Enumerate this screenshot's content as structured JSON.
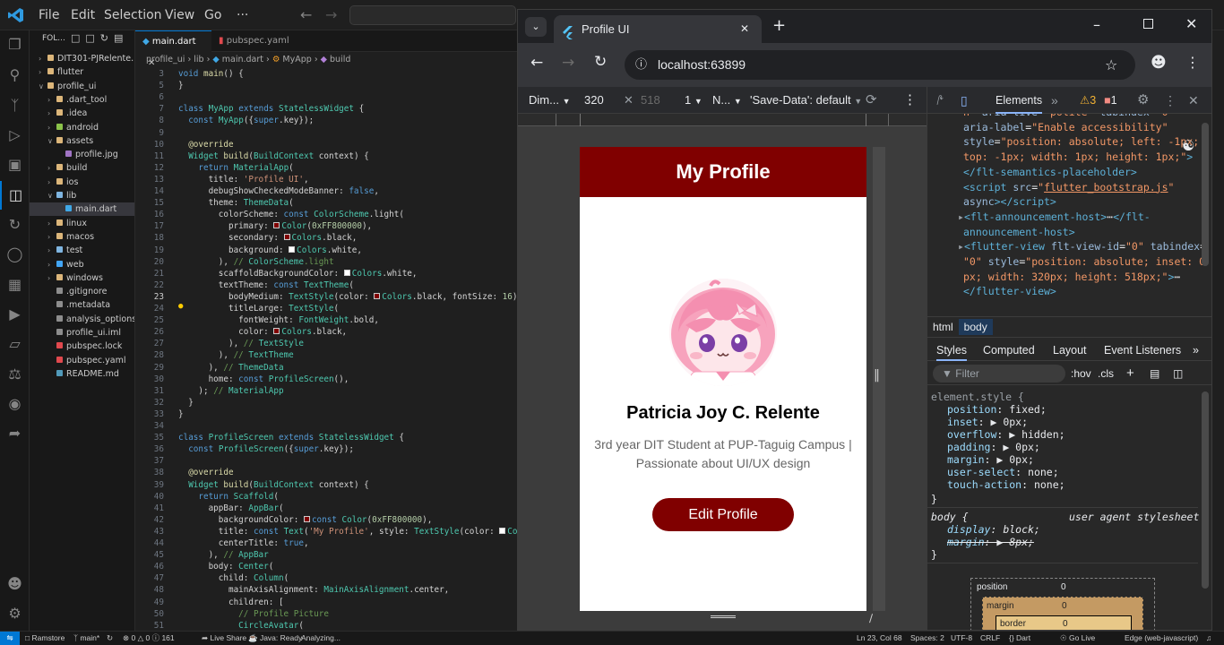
{
  "vscode": {
    "menu": [
      "File",
      "Edit",
      "Selection",
      "View",
      "Go",
      "···"
    ],
    "explorer": {
      "header": "FOL...",
      "items": [
        {
          "label": "DIT301-PJRelente...",
          "indent": 0,
          "type": "folder",
          "open": false
        },
        {
          "label": "flutter",
          "indent": 0,
          "type": "folder",
          "open": false
        },
        {
          "label": "profile_ui",
          "indent": 0,
          "type": "folder",
          "open": true
        },
        {
          "label": ".dart_tool",
          "indent": 1,
          "type": "folder",
          "open": false
        },
        {
          "label": ".idea",
          "indent": 1,
          "type": "folder",
          "open": false
        },
        {
          "label": "android",
          "indent": 1,
          "type": "folder",
          "open": false
        },
        {
          "label": "assets",
          "indent": 1,
          "type": "folder",
          "open": true
        },
        {
          "label": "profile.jpg",
          "indent": 2,
          "type": "file",
          "open": false
        },
        {
          "label": "build",
          "indent": 1,
          "type": "folder",
          "open": false
        },
        {
          "label": "ios",
          "indent": 1,
          "type": "folder",
          "open": false
        },
        {
          "label": "lib",
          "indent": 1,
          "type": "folder",
          "open": true
        },
        {
          "label": "main.dart",
          "indent": 2,
          "type": "file",
          "open": false,
          "selected": true
        },
        {
          "label": "linux",
          "indent": 1,
          "type": "folder",
          "open": false
        },
        {
          "label": "macos",
          "indent": 1,
          "type": "folder",
          "open": false
        },
        {
          "label": "test",
          "indent": 1,
          "type": "folder",
          "open": false
        },
        {
          "label": "web",
          "indent": 1,
          "type": "folder",
          "open": false
        },
        {
          "label": "windows",
          "indent": 1,
          "type": "folder",
          "open": false
        },
        {
          "label": ".gitignore",
          "indent": 1,
          "type": "file",
          "open": false
        },
        {
          "label": ".metadata",
          "indent": 1,
          "type": "file",
          "open": false
        },
        {
          "label": "analysis_options...",
          "indent": 1,
          "type": "file",
          "open": false
        },
        {
          "label": "profile_ui.iml",
          "indent": 1,
          "type": "file",
          "open": false
        },
        {
          "label": "pubspec.lock",
          "indent": 1,
          "type": "file",
          "open": false
        },
        {
          "label": "pubspec.yaml",
          "indent": 1,
          "type": "file",
          "open": false
        },
        {
          "label": "README.md",
          "indent": 1,
          "type": "file",
          "open": false
        }
      ]
    },
    "tabs": [
      {
        "label": "main.dart",
        "active": true
      },
      {
        "label": "pubspec.yaml",
        "active": false
      }
    ],
    "breadcrumb": [
      "profile_ui",
      "lib",
      "main.dart",
      "MyApp",
      "build"
    ],
    "code": [
      {
        "n": "3",
        "t": "void main() {"
      },
      {
        "n": "5",
        "t": "}"
      },
      {
        "n": "6",
        "t": ""
      },
      {
        "n": "7",
        "t": "class MyApp extends StatelessWidget {"
      },
      {
        "n": "8",
        "t": "  const MyApp({super.key});"
      },
      {
        "n": "9",
        "t": ""
      },
      {
        "n": "10",
        "t": "  @override"
      },
      {
        "n": "11",
        "t": "  Widget build(BuildContext context) {"
      },
      {
        "n": "12",
        "t": "    return MaterialApp("
      },
      {
        "n": "13",
        "t": "      title: 'Profile UI',"
      },
      {
        "n": "14",
        "t": "      debugShowCheckedModeBanner: false,"
      },
      {
        "n": "15",
        "t": "      theme: ThemeData("
      },
      {
        "n": "16",
        "t": "        colorScheme: const ColorScheme.light("
      },
      {
        "n": "17",
        "t": "          primary: □Color(0xFF800000),"
      },
      {
        "n": "18",
        "t": "          secondary: □Colors.black,"
      },
      {
        "n": "19",
        "t": "          background: ■Colors.white,"
      },
      {
        "n": "20",
        "t": "        ), // ColorScheme.light"
      },
      {
        "n": "21",
        "t": "        scaffoldBackgroundColor: ■Colors.white,"
      },
      {
        "n": "22",
        "t": "        textTheme: const TextTheme("
      },
      {
        "n": "23",
        "t": "          bodyMedium: TextStyle(color: □Colors.black, fontSize: 16),"
      },
      {
        "n": "24",
        "t": "          titleLarge: TextStyle("
      },
      {
        "n": "25",
        "t": "            fontWeight: FontWeight.bold,"
      },
      {
        "n": "26",
        "t": "            color: □Colors.black,"
      },
      {
        "n": "27",
        "t": "          ), // TextStyle"
      },
      {
        "n": "28",
        "t": "        ), // TextTheme"
      },
      {
        "n": "29",
        "t": "      ), // ThemeData"
      },
      {
        "n": "30",
        "t": "      home: const ProfileScreen(),"
      },
      {
        "n": "31",
        "t": "    ); // MaterialApp"
      },
      {
        "n": "32",
        "t": "  }"
      },
      {
        "n": "33",
        "t": "}"
      },
      {
        "n": "34",
        "t": ""
      },
      {
        "n": "35",
        "t": "class ProfileScreen extends StatelessWidget {"
      },
      {
        "n": "36",
        "t": "  const ProfileScreen({super.key});"
      },
      {
        "n": "37",
        "t": ""
      },
      {
        "n": "38",
        "t": "  @override"
      },
      {
        "n": "39",
        "t": "  Widget build(BuildContext context) {"
      },
      {
        "n": "40",
        "t": "    return Scaffold("
      },
      {
        "n": "41",
        "t": "      appBar: AppBar("
      },
      {
        "n": "42",
        "t": "        backgroundColor: □const Color(0xFF800000),"
      },
      {
        "n": "43",
        "t": "        title: const Text('My Profile', style: TextStyle(color: ■Color"
      },
      {
        "n": "44",
        "t": "        centerTitle: true,"
      },
      {
        "n": "45",
        "t": "      ), // AppBar"
      },
      {
        "n": "46",
        "t": "      body: Center("
      },
      {
        "n": "47",
        "t": "        child: Column("
      },
      {
        "n": "48",
        "t": "          mainAxisAlignment: MainAxisAlignment.center,"
      },
      {
        "n": "49",
        "t": "          children: ["
      },
      {
        "n": "50",
        "t": "            // Profile Picture"
      },
      {
        "n": "51",
        "t": "            CircleAvatar("
      }
    ],
    "status": {
      "branch_remote": "Ramstore",
      "branch": "main*",
      "errors": "0",
      "warnings": "0",
      "info": "161",
      "live_share": "Live Share",
      "java": "Java: Ready",
      "analyzing": "Analyzing...",
      "cursor": "Ln 23, Col 68",
      "spaces": "Spaces: 2",
      "encoding": "UTF-8",
      "eol": "CRLF",
      "language": "Dart",
      "golive": "Go Live",
      "edge": "Edge (web-javascript)"
    }
  },
  "chrome": {
    "tab_title": "Profile UI",
    "url": "localhost:63899",
    "device": {
      "dimensions": "Dim...",
      "width": "320",
      "height": "518",
      "dpr": "1",
      "throttle": "N...",
      "save_data": "'Save-Data': default"
    }
  },
  "app": {
    "appbar_title": "My Profile",
    "name": "Patricia Joy C. Relente",
    "bio": "3rd year DIT Student at PUP-Taguig Campus | Passionate about UI/UX design",
    "button": "Edit Profile",
    "primary_color": "#800000"
  },
  "devtools": {
    "tab_elements": "Elements",
    "warnings": "3",
    "errors": "1",
    "dom_lines": [
      {
        "html": "<span class='attv'>n\"</span> <span class='attn'>aria-live</span>=<span class='attv'>\"polite\"</span> <span class='attn'>tabindex</span>=<span class='attv'>\"0\"</span>"
      },
      {
        "html": "<span class='attn'>aria-label</span>=<span class='attv'>\"Enable accessibility\"</span>"
      },
      {
        "html": "<span class='attn'>style</span>=<span class='attv'>\"position: absolute; left: -1px;</span>"
      },
      {
        "html": "<span class='attv'>top: -1px; width: 1px; height: 1px;\"</span><span class='tagc'>&gt;</span>"
      },
      {
        "html": "<span class='tagc'>&lt;/flt-semantics-placeholder&gt;</span>"
      },
      {
        "html": "<span class='tagc'>&lt;script</span> <span class='attn'>src</span>=<span class='attv'>\"<u>flutter_bootstrap.js</u>\"</span>"
      },
      {
        "html": "<span class='attn'>async</span><span class='tagc'>&gt;&lt;/script&gt;</span>"
      },
      {
        "html": "<span class='tagc'>&lt;flt-announcement-host&gt;</span>⋯<span class='tagc'>&lt;/flt-</span>"
      },
      {
        "html": "<span class='tagc'>announcement-host&gt;</span>"
      },
      {
        "html": "<span class='tagc'>&lt;flutter-view</span> <span class='attn'>flt-view-id</span>=<span class='attv'>\"0\"</span> <span class='attn'>tabindex</span>="
      },
      {
        "html": "<span class='attv'>\"0\"</span> <span class='attn'>style</span>=<span class='attv'>\"position: absolute; inset: 0</span>"
      },
      {
        "html": "<span class='attv'>px; width: 320px; height: 518px;\"</span><span class='tagc'>&gt;</span>⋯"
      },
      {
        "html": "<span class='tagc'>&lt;/flutter-view&gt;</span>"
      }
    ],
    "breadcrumbs": [
      "html",
      "body"
    ],
    "style_tabs": [
      "Styles",
      "Computed",
      "Layout",
      "Event Listeners"
    ],
    "filter_placeholder": "Filter",
    "hov": ":hov",
    "cls": ".cls",
    "element_style": {
      "selector": "element.style {",
      "props": [
        {
          "k": "position",
          "v": "fixed;"
        },
        {
          "k": "inset",
          "v": "▶ 0px;"
        },
        {
          "k": "overflow",
          "v": "▶ hidden;"
        },
        {
          "k": "padding",
          "v": "▶ 0px;"
        },
        {
          "k": "margin",
          "v": "▶ 0px;"
        },
        {
          "k": "user-select",
          "v": "none;"
        },
        {
          "k": "touch-action",
          "v": "none;"
        }
      ]
    },
    "body_rule": {
      "selector": "body {",
      "source": "user agent stylesheet",
      "props": [
        {
          "k": "display",
          "v": "block;"
        },
        {
          "k": "margin",
          "v": "▶ 8px;"
        }
      ]
    },
    "boxmodel": {
      "position": "position",
      "position_v": "0",
      "margin": "margin",
      "margin_v": "0",
      "border": "border",
      "border_v": "0"
    }
  }
}
